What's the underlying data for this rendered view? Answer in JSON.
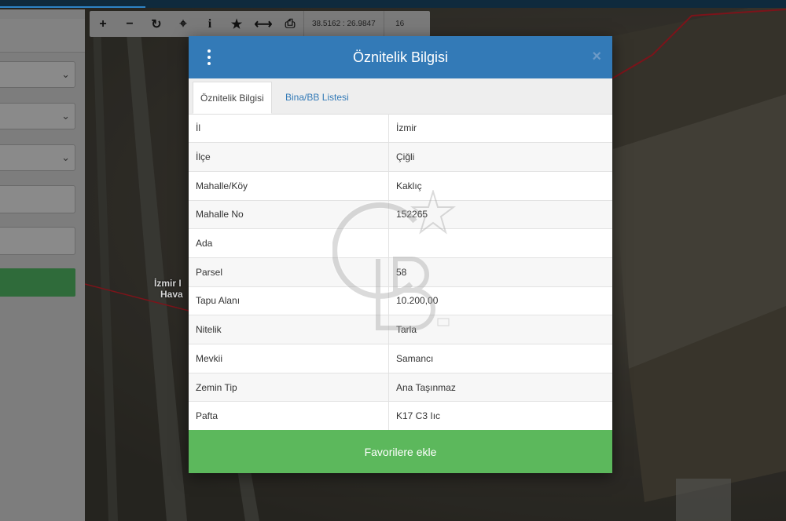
{
  "toolbar": {
    "buttons": [
      {
        "name": "zoom-in-button",
        "glyph": "+"
      },
      {
        "name": "zoom-out-button",
        "glyph": "−"
      },
      {
        "name": "refresh-button",
        "glyph": "↻"
      },
      {
        "name": "locate-button",
        "glyph": "⌖"
      },
      {
        "name": "info-button",
        "glyph": "i"
      },
      {
        "name": "favorite-button",
        "glyph": "★"
      },
      {
        "name": "measure-button",
        "glyph": "⟷"
      },
      {
        "name": "print-button",
        "glyph": "⎙"
      }
    ],
    "coordinates": "38.5162 : 26.9847",
    "zoom": "16"
  },
  "map": {
    "label_line1": "İzmir I",
    "label_line2": "Hava"
  },
  "modal": {
    "title": "Öznitelik Bilgisi",
    "close": "×",
    "tabs": [
      {
        "label": "Öznitelik Bilgisi",
        "active": true
      },
      {
        "label": "Bina/BB Listesi",
        "active": false
      }
    ],
    "rows": [
      {
        "key": "İl",
        "value": "İzmir"
      },
      {
        "key": "İlçe",
        "value": "Çiğli"
      },
      {
        "key": "Mahalle/Köy",
        "value": "Kaklıç"
      },
      {
        "key": "Mahalle No",
        "value": "152265"
      },
      {
        "key": "Ada",
        "value": ""
      },
      {
        "key": "Parsel",
        "value": "58"
      },
      {
        "key": "Tapu Alanı",
        "value": "10.200,00"
      },
      {
        "key": "Nitelik",
        "value": "Tarla"
      },
      {
        "key": "Mevkii",
        "value": "Samancı"
      },
      {
        "key": "Zemin Tip",
        "value": "Ana Taşınmaz"
      },
      {
        "key": "Pafta",
        "value": "K17 C3 Iıc"
      }
    ],
    "favorite_button": "Favorilere ekle"
  },
  "colors": {
    "header_blue": "#337ab7",
    "button_green": "#5cb85c",
    "tab_link": "#337ab7",
    "route_red": "#c8202a"
  },
  "watermark": {
    "text": "GB",
    "badge": "SM"
  }
}
